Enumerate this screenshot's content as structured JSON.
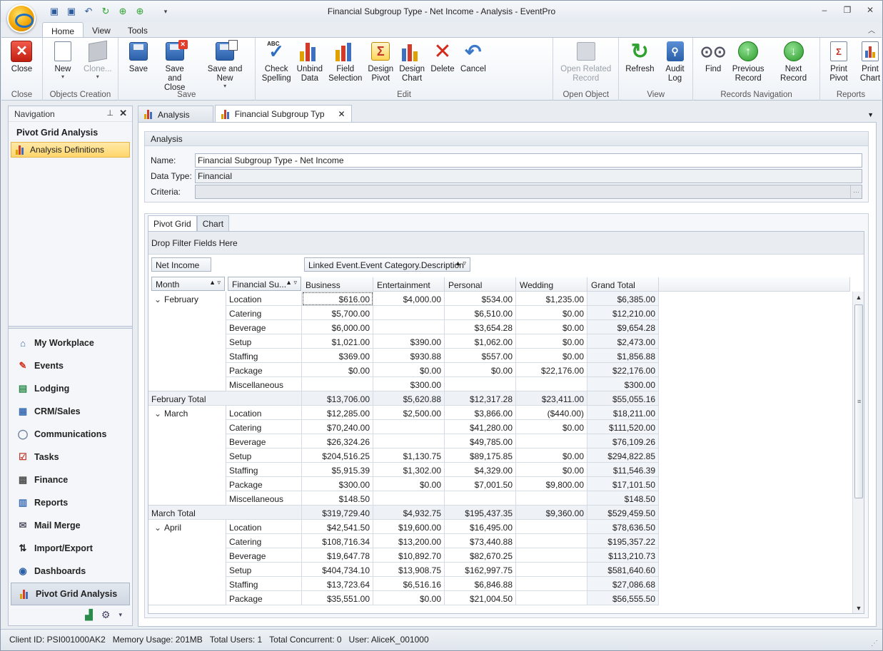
{
  "window": {
    "title": "Financial Subgroup Type - Net Income - Analysis - EventPro"
  },
  "ribbon_tabs": [
    "Home",
    "View",
    "Tools"
  ],
  "ribbon": {
    "close": {
      "close": "Close",
      "group": "Close"
    },
    "objects": {
      "new": "New",
      "clone": "Clone...",
      "group": "Objects Creation"
    },
    "save": {
      "save": "Save",
      "save_close_1": "Save and",
      "save_close_2": "Close",
      "save_new": "Save and New",
      "group": "Save"
    },
    "edit": {
      "check_1": "Check",
      "check_2": "Spelling",
      "unbind_1": "Unbind",
      "unbind_2": "Data",
      "field_1": "Field",
      "field_2": "Selection",
      "dpivot_1": "Design",
      "dpivot_2": "Pivot",
      "dchart_1": "Design",
      "dchart_2": "Chart",
      "delete": "Delete",
      "cancel": "Cancel",
      "group": "Edit"
    },
    "open": {
      "related_1": "Open Related",
      "related_2": "Record",
      "group": "Open Object"
    },
    "view": {
      "refresh": "Refresh",
      "audit_1": "Audit",
      "audit_2": "Log",
      "group": "View"
    },
    "nav": {
      "find": "Find",
      "prev_1": "Previous",
      "prev_2": "Record",
      "next": "Next Record",
      "group": "Records Navigation"
    },
    "reports": {
      "ppivot_1": "Print",
      "ppivot_2": "Pivot",
      "pchart_1": "Print",
      "pchart_2": "Chart",
      "group": "Reports"
    }
  },
  "navigation": {
    "header": "Navigation",
    "title": "Pivot Grid Analysis",
    "item": "Analysis Definitions",
    "modules": [
      "My Workplace",
      "Events",
      "Lodging",
      "CRM/Sales",
      "Communications",
      "Tasks",
      "Finance",
      "Reports",
      "Mail Merge",
      "Import/Export",
      "Dashboards",
      "Pivot Grid Analysis"
    ]
  },
  "doc_tabs": [
    "Analysis",
    "Financial Subgroup Typ"
  ],
  "analysis": {
    "header": "Analysis",
    "name_label": "Name:",
    "name_value": "Financial Subgroup Type - Net Income",
    "type_label": "Data Type:",
    "type_value": "Financial",
    "criteria_label": "Criteria:",
    "criteria_value": "",
    "ellipsis": "…"
  },
  "pivot_tabs": [
    "Pivot Grid",
    "Chart"
  ],
  "pivot": {
    "filter_text": "Drop Filter Fields Here",
    "data_field": "Net Income",
    "column_field": "Linked Event.Event Category.Description",
    "row_field_1": "Month",
    "row_field_2": "Financial Su...",
    "columns": [
      "Business",
      "Entertainment",
      "Personal",
      "Wedding",
      "Grand Total"
    ],
    "groups": [
      {
        "month": "February",
        "total_label": "February Total",
        "rows": [
          {
            "sub": "Location",
            "v": [
              "$616.00",
              "$4,000.00",
              "$534.00",
              "$1,235.00",
              "$6,385.00"
            ]
          },
          {
            "sub": "Catering",
            "v": [
              "$5,700.00",
              "",
              "$6,510.00",
              "$0.00",
              "$12,210.00"
            ]
          },
          {
            "sub": "Beverage",
            "v": [
              "$6,000.00",
              "",
              "$3,654.28",
              "$0.00",
              "$9,654.28"
            ]
          },
          {
            "sub": "Setup",
            "v": [
              "$1,021.00",
              "$390.00",
              "$1,062.00",
              "$0.00",
              "$2,473.00"
            ]
          },
          {
            "sub": "Staffing",
            "v": [
              "$369.00",
              "$930.88",
              "$557.00",
              "$0.00",
              "$1,856.88"
            ]
          },
          {
            "sub": "Package",
            "v": [
              "$0.00",
              "$0.00",
              "$0.00",
              "$22,176.00",
              "$22,176.00"
            ]
          },
          {
            "sub": "Miscellaneous",
            "v": [
              "",
              "$300.00",
              "",
              "",
              "$300.00"
            ]
          }
        ],
        "total": [
          "$13,706.00",
          "$5,620.88",
          "$12,317.28",
          "$23,411.00",
          "$55,055.16"
        ]
      },
      {
        "month": "March",
        "total_label": "March Total",
        "rows": [
          {
            "sub": "Location",
            "v": [
              "$12,285.00",
              "$2,500.00",
              "$3,866.00",
              "($440.00)",
              "$18,211.00"
            ]
          },
          {
            "sub": "Catering",
            "v": [
              "$70,240.00",
              "",
              "$41,280.00",
              "$0.00",
              "$111,520.00"
            ]
          },
          {
            "sub": "Beverage",
            "v": [
              "$26,324.26",
              "",
              "$49,785.00",
              "",
              "$76,109.26"
            ]
          },
          {
            "sub": "Setup",
            "v": [
              "$204,516.25",
              "$1,130.75",
              "$89,175.85",
              "$0.00",
              "$294,822.85"
            ]
          },
          {
            "sub": "Staffing",
            "v": [
              "$5,915.39",
              "$1,302.00",
              "$4,329.00",
              "$0.00",
              "$11,546.39"
            ]
          },
          {
            "sub": "Package",
            "v": [
              "$300.00",
              "$0.00",
              "$7,001.50",
              "$9,800.00",
              "$17,101.50"
            ]
          },
          {
            "sub": "Miscellaneous",
            "v": [
              "$148.50",
              "",
              "",
              "",
              "$148.50"
            ]
          }
        ],
        "total": [
          "$319,729.40",
          "$4,932.75",
          "$195,437.35",
          "$9,360.00",
          "$529,459.50"
        ]
      },
      {
        "month": "April",
        "total_label": "",
        "rows": [
          {
            "sub": "Location",
            "v": [
              "$42,541.50",
              "$19,600.00",
              "$16,495.00",
              "",
              "$78,636.50"
            ]
          },
          {
            "sub": "Catering",
            "v": [
              "$108,716.34",
              "$13,200.00",
              "$73,440.88",
              "",
              "$195,357.22"
            ]
          },
          {
            "sub": "Beverage",
            "v": [
              "$19,647.78",
              "$10,892.70",
              "$82,670.25",
              "",
              "$113,210.73"
            ]
          },
          {
            "sub": "Setup",
            "v": [
              "$404,734.10",
              "$13,908.75",
              "$162,997.75",
              "",
              "$581,640.60"
            ]
          },
          {
            "sub": "Staffing",
            "v": [
              "$13,723.64",
              "$6,516.16",
              "$6,846.88",
              "",
              "$27,086.68"
            ]
          },
          {
            "sub": "Package",
            "v": [
              "$35,551.00",
              "$0.00",
              "$21,004.50",
              "",
              "$56,555.50"
            ]
          }
        ],
        "total": null
      }
    ]
  },
  "status": {
    "client": "Client ID: PSI001000AK2",
    "memory": "Memory Usage: 201MB",
    "users": "Total Users: 1",
    "concurrent": "Total Concurrent: 0",
    "user": "User: AliceK_001000"
  },
  "colors": {
    "accent": "#2b5fa8",
    "selection": "#ffd66b",
    "close_red": "#c11f12",
    "go_green": "#2a9a2a"
  }
}
